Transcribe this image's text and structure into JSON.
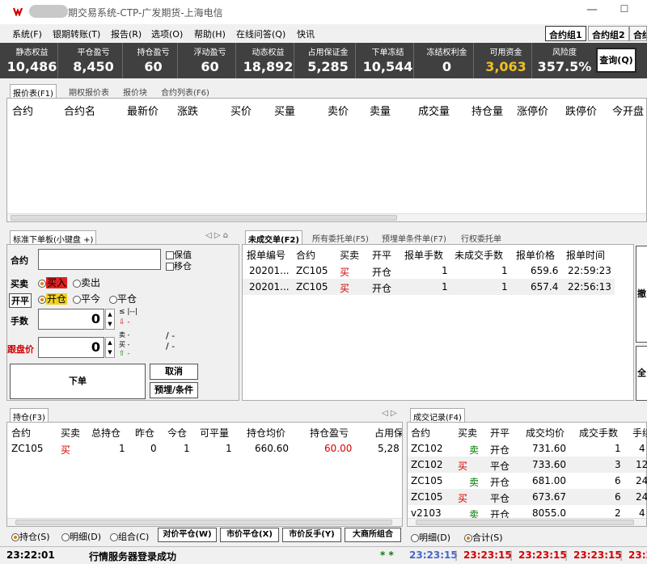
{
  "window": {
    "title": "期交易系统-CTP-广发期货-上海电信",
    "min_glyph": "—",
    "max_glyph": "☐"
  },
  "menu": [
    "系统(F)",
    "银期转账(T)",
    "报告(R)",
    "选项(O)",
    "帮助(H)",
    "在线问答(Q)",
    "快讯"
  ],
  "group_tabs": [
    "合约组1",
    "合约组2",
    "合约"
  ],
  "account": [
    {
      "label": "静态权益",
      "value": "10,486"
    },
    {
      "label": "平仓盈亏",
      "value": "8,450"
    },
    {
      "label": "持仓盈亏",
      "value": "60"
    },
    {
      "label": "浮动盈亏",
      "value": "60"
    },
    {
      "label": "动态权益",
      "value": "18,892"
    },
    {
      "label": "占用保证金",
      "value": "5,285"
    },
    {
      "label": "下单冻结",
      "value": "10,544"
    },
    {
      "label": "冻结权利金",
      "value": "0"
    },
    {
      "label": "可用资金",
      "value": "3,063"
    },
    {
      "label": "风险度",
      "value": "357.5%"
    }
  ],
  "query_button": "查询(Q)",
  "quote_tabs": [
    "报价表(F1)",
    "期权报价表",
    "报价块",
    "合约列表(F6)"
  ],
  "quote_headers": [
    "合约",
    "合约名",
    "最新价",
    "涨跌",
    "买价",
    "买量",
    "卖价",
    "卖量",
    "成交量",
    "持仓量",
    "涨停价",
    "跌停价",
    "今开盘"
  ],
  "order_panel": {
    "tab": "标准下单板(小键盘 +)",
    "contract_label": "合约",
    "keep_value": "保值",
    "move_position": "移仓",
    "direction_label": "买卖",
    "buy": "买入",
    "sell": "卖出",
    "offset_label": "开平",
    "open": "开仓",
    "close_today": "平今",
    "close": "平仓",
    "qty_label": "手数",
    "qty_value": "0",
    "price_label": "跟盘价",
    "price_value": "0",
    "max_mark": "≤ |--|",
    "sell_mark": "卖",
    "buy_mark": "买",
    "dash": "-",
    "slash_dash": "/ -",
    "submit": "下单",
    "cancel": "取消",
    "preorder": "预埋/条件"
  },
  "pending_tabs": [
    "未成交单(F2)",
    "所有委托单(F5)",
    "预埋单条件单(F7)",
    "行权委托单"
  ],
  "pending_headers": [
    "报单编号",
    "合约",
    "买卖",
    "开平",
    "报单手数",
    "未成交手数",
    "报单价格",
    "报单时间"
  ],
  "pending_rows": [
    {
      "id": "20201...",
      "contract": "ZC105",
      "side": "买",
      "offset": "开仓",
      "qty": "1",
      "unfilled": "1",
      "price": "659.6",
      "time": "22:59:23"
    },
    {
      "id": "20201...",
      "contract": "ZC105",
      "side": "买",
      "offset": "开仓",
      "qty": "1",
      "unfilled": "1",
      "price": "657.4",
      "time": "22:56:13"
    }
  ],
  "side_buttons": [
    "撤",
    "全"
  ],
  "position_tab": "持仓(F3)",
  "position_headers": [
    "合约",
    "买卖",
    "总持仓",
    "昨仓",
    "今仓",
    "可平量",
    "持仓均价",
    "持仓盈亏",
    "占用保"
  ],
  "position_rows": [
    {
      "contract": "ZC105",
      "side": "买",
      "total": "1",
      "yesterday": "0",
      "today": "1",
      "closable": "1",
      "avg": "660.60",
      "pnl": "60.00",
      "margin": "5,28"
    }
  ],
  "position_footer": {
    "radio_hold": "持仓(S)",
    "radio_detail": "明细(D)",
    "radio_combo": "组合(C)",
    "btn_counter": "对价平仓(W)",
    "btn_market": "市价平仓(X)",
    "btn_reverse": "市价反手(Y)",
    "btn_exchange": "大商所组合"
  },
  "trade_tab": "成交记录(F4)",
  "trade_headers": [
    "合约",
    "买卖",
    "开平",
    "成交均价",
    "成交手数",
    "手续"
  ],
  "trade_rows": [
    {
      "contract": "ZC102",
      "side": "卖",
      "offset": "开仓",
      "price": "731.60",
      "qty": "1",
      "fee": "4"
    },
    {
      "contract": "ZC102",
      "side": "买",
      "offset": "平仓",
      "price": "733.60",
      "qty": "3",
      "fee": "12"
    },
    {
      "contract": "ZC105",
      "side": "卖",
      "offset": "开仓",
      "price": "681.00",
      "qty": "6",
      "fee": "24"
    },
    {
      "contract": "ZC105",
      "side": "买",
      "offset": "平仓",
      "price": "673.67",
      "qty": "6",
      "fee": "24"
    },
    {
      "contract": "v2103",
      "side": "卖",
      "offset": "开仓",
      "price": "8055.0",
      "qty": "2",
      "fee": "4"
    }
  ],
  "trade_footer": {
    "radio_detail": "明细(D)",
    "radio_total": "合计(S)"
  },
  "status": {
    "time": "23:22:01",
    "message": "行情服务器登录成功",
    "stars": "* *",
    "times": [
      "23:23:15",
      "23:23:15",
      "23:23:15",
      "23:23:15",
      "23:2"
    ]
  },
  "colors": {
    "buy": "#d40000",
    "sell": "#007a00",
    "available_funds": "#f0c020",
    "account_bg": "#404040"
  }
}
